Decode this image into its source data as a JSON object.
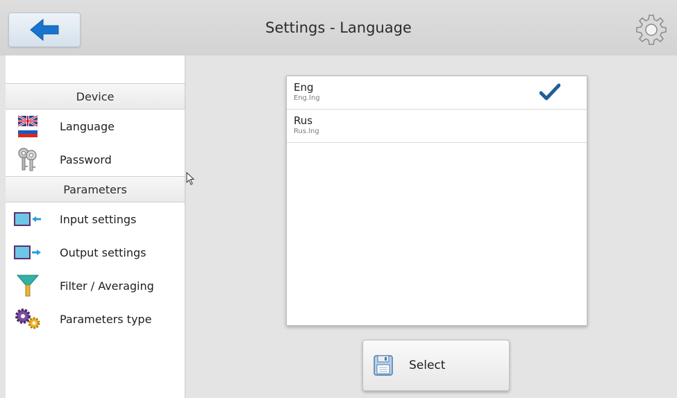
{
  "header": {
    "title": "Settings - Language",
    "back_icon": "arrow-left-icon",
    "settings_icon": "gear-icon"
  },
  "sidebar": {
    "sections": [
      {
        "title": "Device",
        "items": [
          {
            "label": "Language",
            "icon": "flag-icon"
          },
          {
            "label": "Password",
            "icon": "keys-icon"
          }
        ]
      },
      {
        "title": "Parameters",
        "items": [
          {
            "label": "Input settings",
            "icon": "input-settings-icon"
          },
          {
            "label": "Output settings",
            "icon": "output-settings-icon"
          },
          {
            "label": "Filter / Averaging",
            "icon": "filter-icon"
          },
          {
            "label": "Parameters type",
            "icon": "gears-icon"
          }
        ]
      }
    ]
  },
  "languages": [
    {
      "name": "Eng",
      "file": "Eng.lng",
      "selected": true
    },
    {
      "name": "Rus",
      "file": "Rus.lng",
      "selected": false
    }
  ],
  "select_button": {
    "label": "Select",
    "icon": "floppy-disk-icon"
  },
  "colors": {
    "accent": "#1874cd",
    "checkmark": "#1f5f99"
  }
}
